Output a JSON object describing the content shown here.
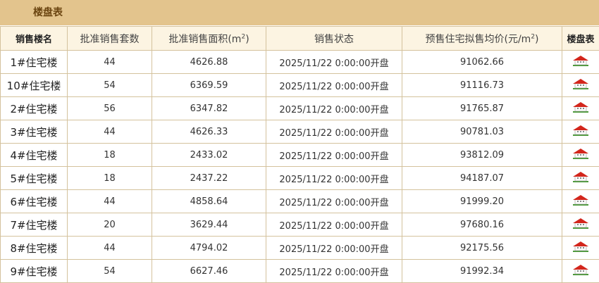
{
  "header": {
    "title": "楼盘表"
  },
  "columns": {
    "name": "销售楼名",
    "units": "批准销售套数",
    "area_prefix": "批准销售面积(m",
    "area_sup": "2",
    "area_suffix": ")",
    "status": "销售状态",
    "price_prefix": "预售住宅拟售均价(元/m",
    "price_sup": "2",
    "price_suffix": ")",
    "table_link": "楼盘表"
  },
  "icon": "house-icon",
  "colors": {
    "header_bar": "#e3c48d",
    "header_text": "#6b4511",
    "column_header_bg": "#fcf4e2",
    "border": "#d4c29d"
  },
  "rows": [
    {
      "name": "1#住宅楼",
      "units": "44",
      "area": "4626.88",
      "status": "2025/11/22 0:00:00开盘",
      "price": "91062.66"
    },
    {
      "name": "10#住宅楼",
      "units": "54",
      "area": "6369.59",
      "status": "2025/11/22 0:00:00开盘",
      "price": "91116.73"
    },
    {
      "name": "2#住宅楼",
      "units": "56",
      "area": "6347.82",
      "status": "2025/11/22 0:00:00开盘",
      "price": "91765.87"
    },
    {
      "name": "3#住宅楼",
      "units": "44",
      "area": "4626.33",
      "status": "2025/11/22 0:00:00开盘",
      "price": "90781.03"
    },
    {
      "name": "4#住宅楼",
      "units": "18",
      "area": "2433.02",
      "status": "2025/11/22 0:00:00开盘",
      "price": "93812.09"
    },
    {
      "name": "5#住宅楼",
      "units": "18",
      "area": "2437.22",
      "status": "2025/11/22 0:00:00开盘",
      "price": "94187.07"
    },
    {
      "name": "6#住宅楼",
      "units": "44",
      "area": "4858.64",
      "status": "2025/11/22 0:00:00开盘",
      "price": "91999.20"
    },
    {
      "name": "7#住宅楼",
      "units": "20",
      "area": "3629.44",
      "status": "2025/11/22 0:00:00开盘",
      "price": "97680.16"
    },
    {
      "name": "8#住宅楼",
      "units": "44",
      "area": "4794.02",
      "status": "2025/11/22 0:00:00开盘",
      "price": "92175.56"
    },
    {
      "name": "9#住宅楼",
      "units": "54",
      "area": "6627.46",
      "status": "2025/11/22 0:00:00开盘",
      "price": "91992.34"
    }
  ]
}
